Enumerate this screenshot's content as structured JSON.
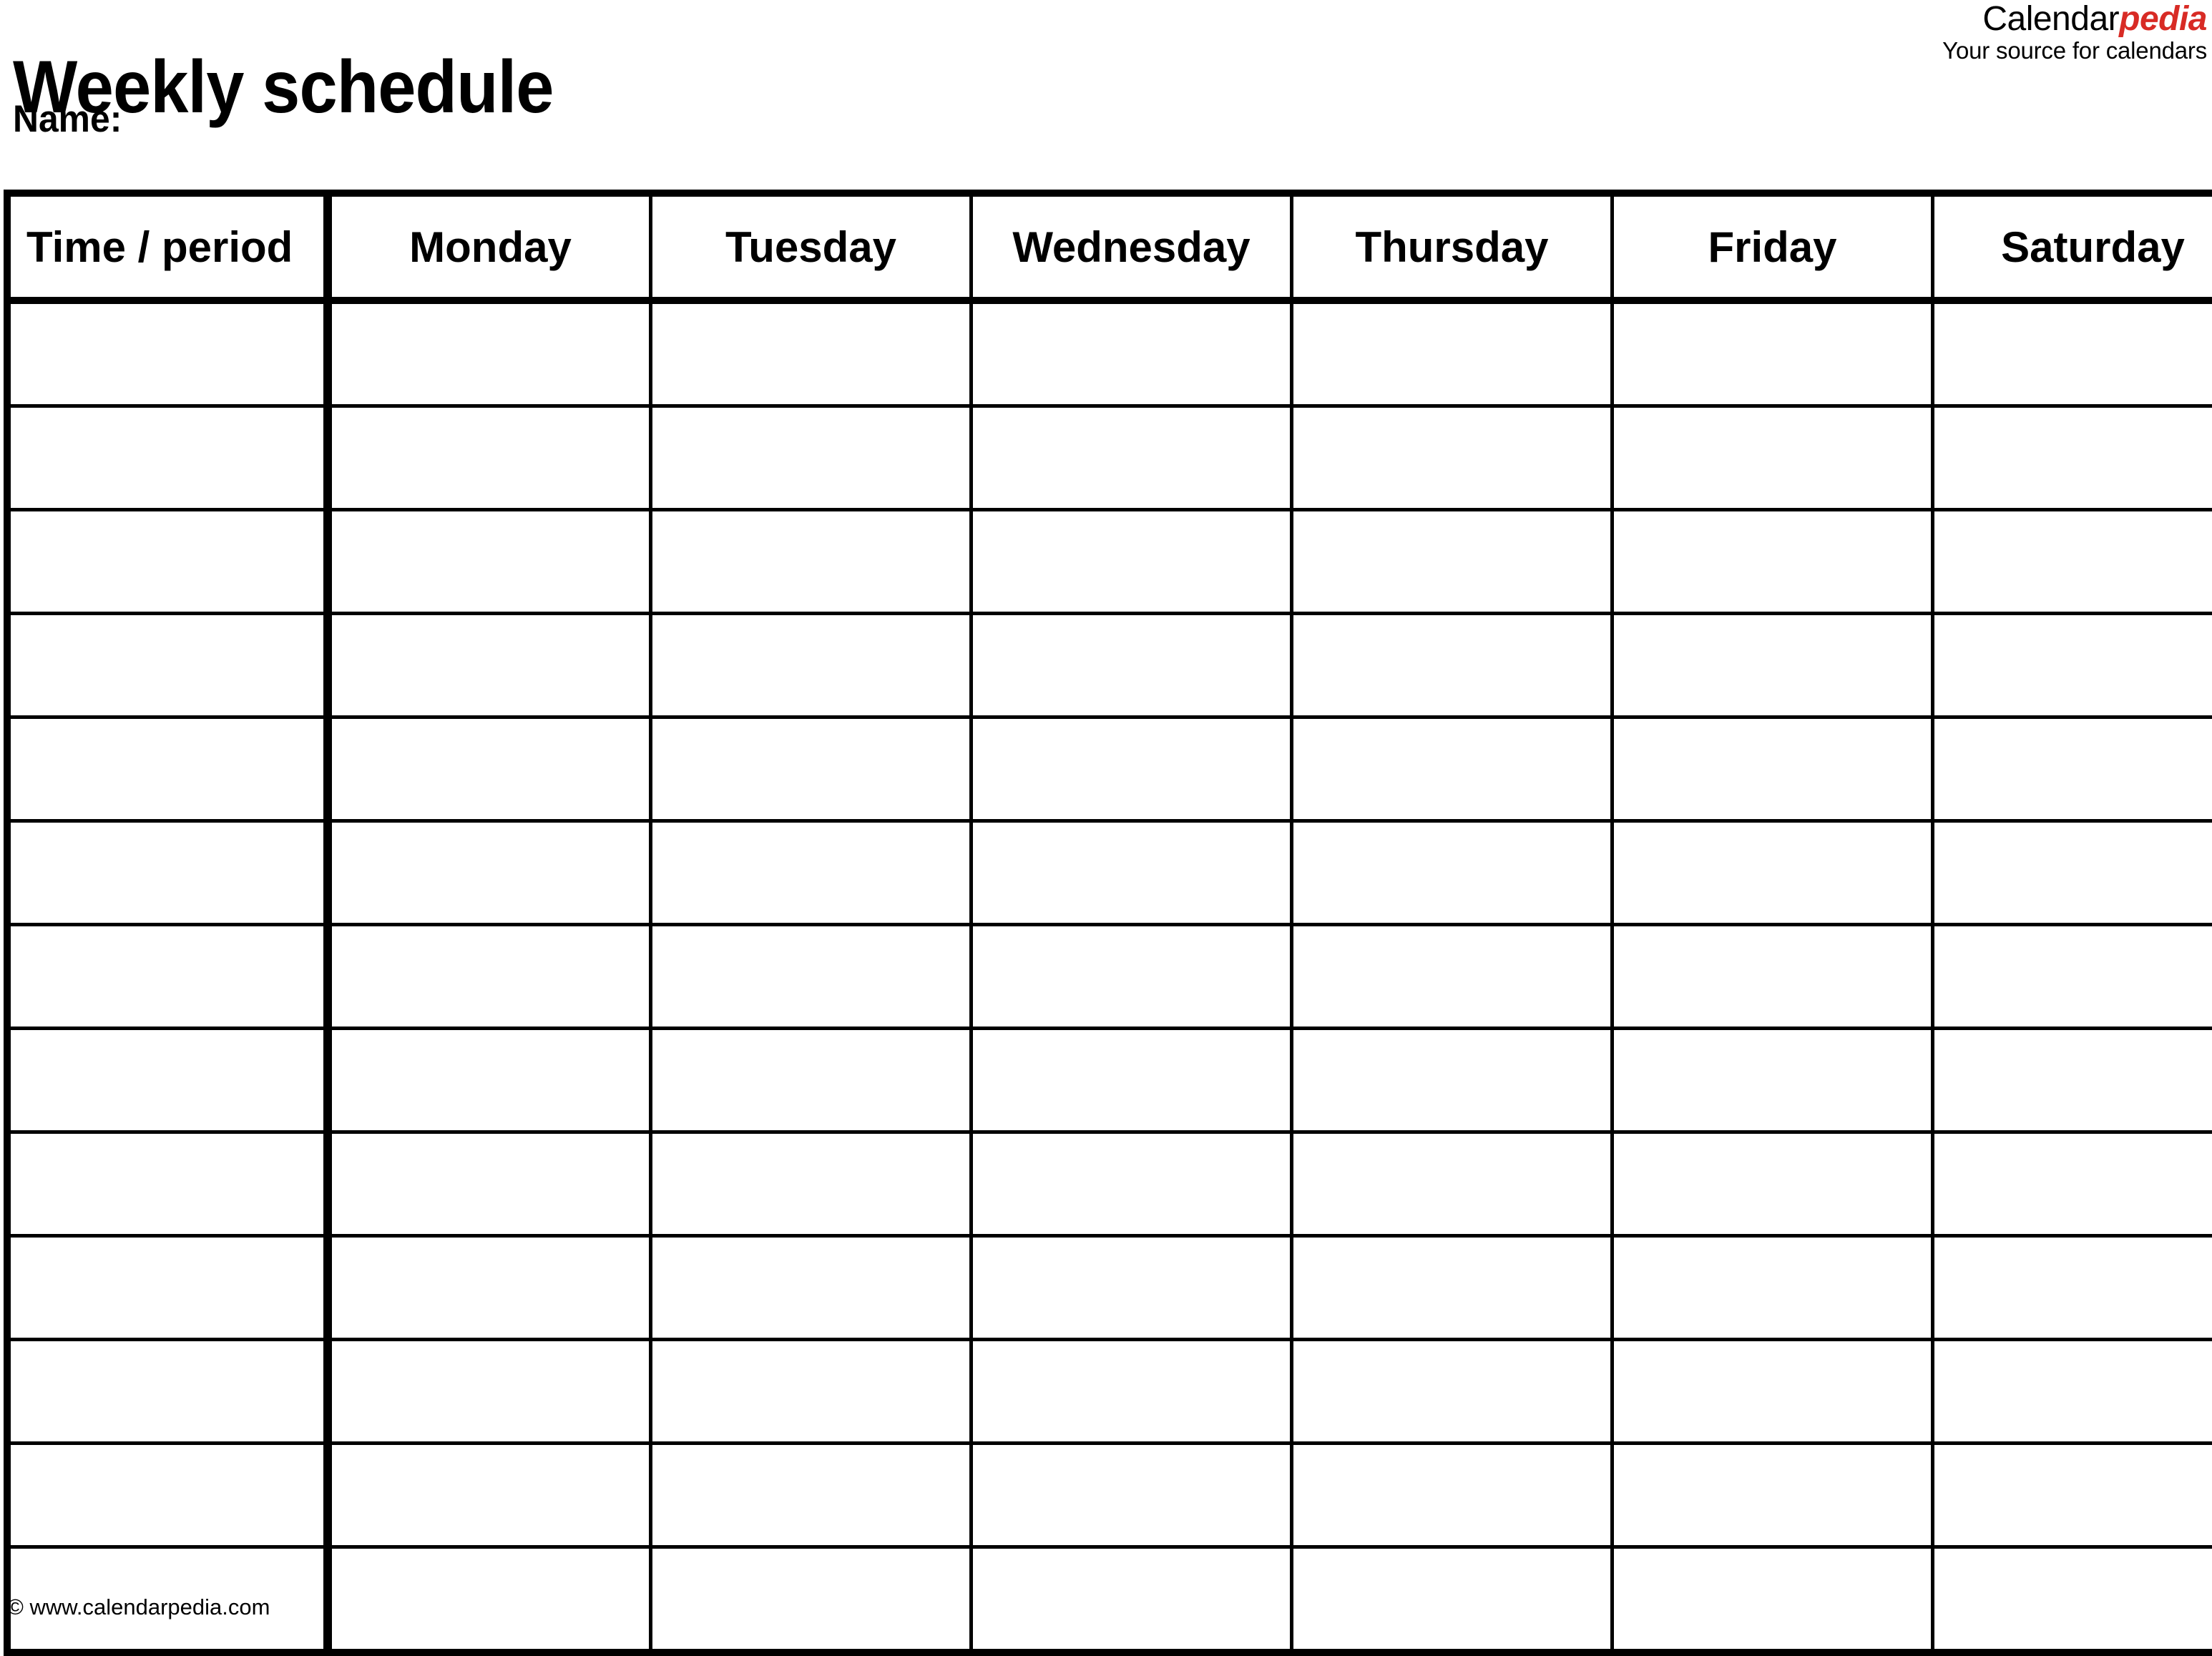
{
  "document": {
    "title": "Weekly schedule",
    "name_label": "Name:"
  },
  "brand": {
    "word_main": "Calendar",
    "word_accent": "pedia",
    "tagline": "Your source for calendars",
    "accent_color": "#d82b25"
  },
  "table": {
    "columns": [
      "Time / period",
      "Monday",
      "Tuesday",
      "Wednesday",
      "Thursday",
      "Friday",
      "Saturday"
    ],
    "row_count": 13,
    "rows": [
      [
        "",
        "",
        "",
        "",
        "",
        "",
        ""
      ],
      [
        "",
        "",
        "",
        "",
        "",
        "",
        ""
      ],
      [
        "",
        "",
        "",
        "",
        "",
        "",
        ""
      ],
      [
        "",
        "",
        "",
        "",
        "",
        "",
        ""
      ],
      [
        "",
        "",
        "",
        "",
        "",
        "",
        ""
      ],
      [
        "",
        "",
        "",
        "",
        "",
        "",
        ""
      ],
      [
        "",
        "",
        "",
        "",
        "",
        "",
        ""
      ],
      [
        "",
        "",
        "",
        "",
        "",
        "",
        ""
      ],
      [
        "",
        "",
        "",
        "",
        "",
        "",
        ""
      ],
      [
        "",
        "",
        "",
        "",
        "",
        "",
        ""
      ],
      [
        "",
        "",
        "",
        "",
        "",
        "",
        ""
      ],
      [
        "",
        "",
        "",
        "",
        "",
        "",
        ""
      ],
      [
        "",
        "",
        "",
        "",
        "",
        "",
        ""
      ]
    ]
  },
  "footer": {
    "copyright": "© www.calendarpedia.com"
  }
}
